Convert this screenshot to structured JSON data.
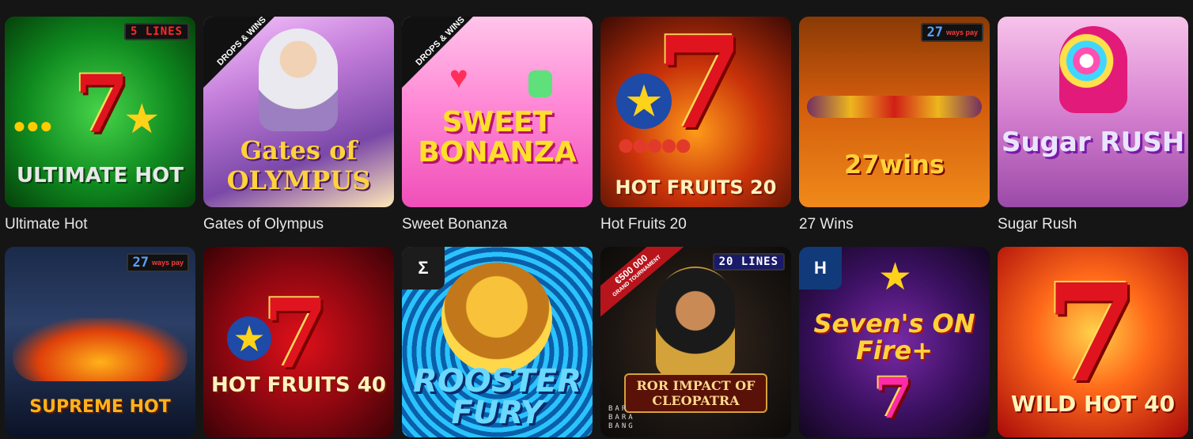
{
  "games": [
    {
      "title": "Ultimate Hot",
      "badge": "5 LINES",
      "logo": "ULTIMATE HOT"
    },
    {
      "title": "Gates of Olympus",
      "badge": "DROPS & WINS",
      "logo": "Gates of OLYMPUS"
    },
    {
      "title": "Sweet Bonanza",
      "badge": "DROPS & WINS",
      "logo": "SWEET BONANZA"
    },
    {
      "title": "Hot Fruits 20",
      "logo": "HOT FRUITS 20"
    },
    {
      "title": "27 Wins",
      "badge_num": "27",
      "badge_txt": "ways pay",
      "logo": "27wins"
    },
    {
      "title": "Sugar Rush",
      "logo": "Sugar RUSH"
    },
    {
      "title": "Supreme Hot",
      "badge_num": "27",
      "badge_txt": "ways pay",
      "logo": "SUPREME HOT"
    },
    {
      "title": "Hot Fruits 40",
      "logo": "HOT FRUITS 40"
    },
    {
      "title": "Rooster Fury",
      "logo": "ROOSTER FURY"
    },
    {
      "title": "Impact of Cleopatra",
      "badge": "20 LINES",
      "tourney": "€500 000",
      "tourney_sub": "GRAND TOURNAMENT",
      "logo": "ROR IMPACT OF CLEOPATRA",
      "provider": "BAR BARA BANG"
    },
    {
      "title": "Sevens on Fire+",
      "provider_icon": "H",
      "logo": "Seven's ON Fire+"
    },
    {
      "title": "Wild Hot 40",
      "logo": "WILD HOT 40"
    }
  ],
  "colors": {
    "background": "#151515",
    "title_text": "#e8e8e8"
  }
}
